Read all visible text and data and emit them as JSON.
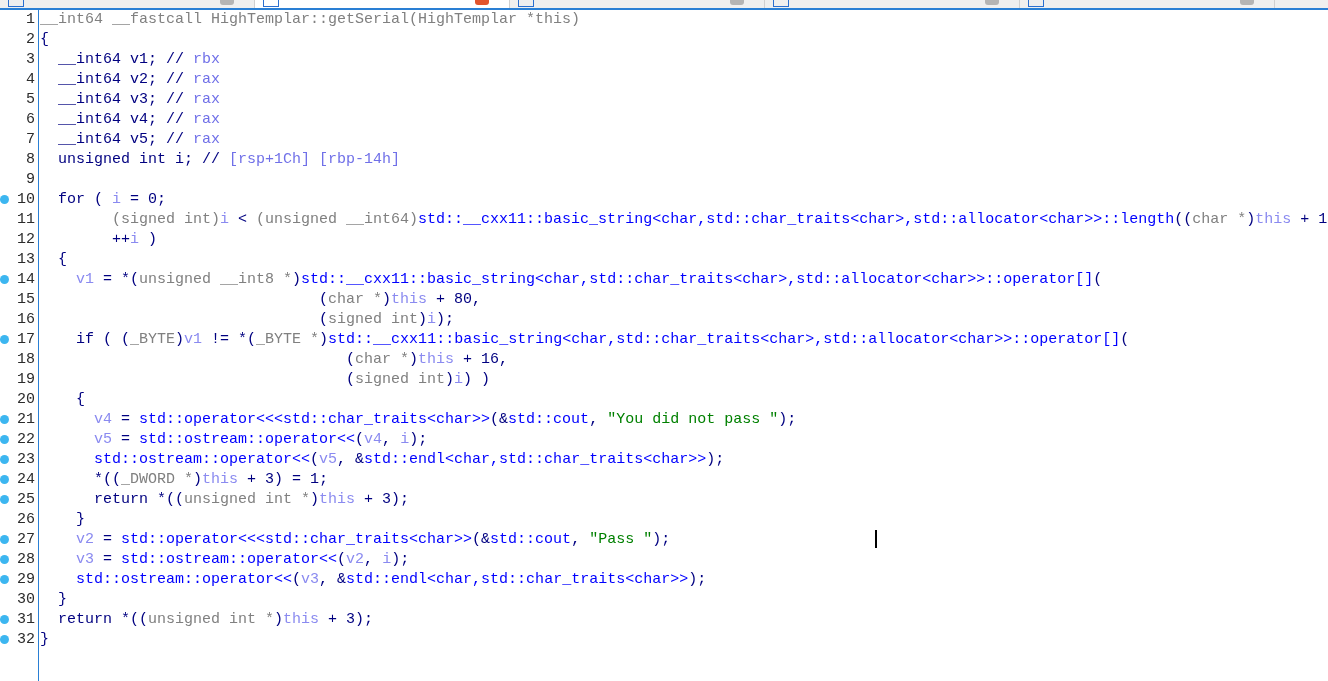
{
  "tabs": [
    {
      "selected": false
    },
    {
      "selected": true
    },
    {
      "selected": false
    },
    {
      "selected": false
    },
    {
      "selected": false
    }
  ],
  "lines": [
    {
      "n": "1",
      "bp": false,
      "tokens": [
        {
          "kind": "type",
          "t": "__int64 __fastcall HighTemplar::getSerial(HighTemplar *this)"
        }
      ]
    },
    {
      "n": "2",
      "bp": false,
      "tokens": [
        {
          "kind": "plain",
          "t": "{"
        }
      ]
    },
    {
      "n": "3",
      "bp": false,
      "tokens": [
        {
          "kind": "plain",
          "t": "  __int64 v1; // "
        },
        {
          "kind": "comment",
          "t": "rbx"
        }
      ]
    },
    {
      "n": "4",
      "bp": false,
      "tokens": [
        {
          "kind": "plain",
          "t": "  __int64 v2; // "
        },
        {
          "kind": "comment",
          "t": "rax"
        }
      ]
    },
    {
      "n": "5",
      "bp": false,
      "tokens": [
        {
          "kind": "plain",
          "t": "  __int64 v3; // "
        },
        {
          "kind": "comment",
          "t": "rax"
        }
      ]
    },
    {
      "n": "6",
      "bp": false,
      "tokens": [
        {
          "kind": "plain",
          "t": "  __int64 v4; // "
        },
        {
          "kind": "comment",
          "t": "rax"
        }
      ]
    },
    {
      "n": "7",
      "bp": false,
      "tokens": [
        {
          "kind": "plain",
          "t": "  __int64 v5; // "
        },
        {
          "kind": "comment",
          "t": "rax"
        }
      ]
    },
    {
      "n": "8",
      "bp": false,
      "tokens": [
        {
          "kind": "plain",
          "t": "  unsigned int i; // "
        },
        {
          "kind": "comment",
          "t": "[rsp+1Ch] [rbp-14h]"
        }
      ]
    },
    {
      "n": "9",
      "bp": false
    },
    {
      "n": "10",
      "bp": true,
      "tokens": [
        {
          "kind": "plain",
          "t": "  for ( "
        },
        {
          "kind": "var",
          "t": "i"
        },
        {
          "kind": "plain",
          "t": " = 0;"
        }
      ]
    },
    {
      "n": "11",
      "bp": false,
      "tokens": [
        {
          "kind": "type",
          "t": "        (signed int)"
        },
        {
          "kind": "var",
          "t": "i"
        },
        {
          "kind": "plain",
          "t": " < "
        },
        {
          "kind": "type",
          "t": "(unsigned __int64)"
        },
        {
          "kind": "func",
          "t": "std::__cxx11::basic_string<char,std::char_traits<char>,std::allocator<char>>::length"
        },
        {
          "kind": "plain",
          "t": "(("
        },
        {
          "kind": "type",
          "t": "char *"
        },
        {
          "kind": "plain",
          "t": ")"
        },
        {
          "kind": "var",
          "t": "this"
        },
        {
          "kind": "plain",
          "t": " + 1"
        }
      ]
    },
    {
      "n": "12",
      "bp": false,
      "tokens": [
        {
          "kind": "plain",
          "t": "        ++"
        },
        {
          "kind": "var",
          "t": "i"
        },
        {
          "kind": "plain",
          "t": " )"
        }
      ]
    },
    {
      "n": "13",
      "bp": false,
      "tokens": [
        {
          "kind": "plain",
          "t": "  {"
        }
      ]
    },
    {
      "n": "14",
      "bp": true,
      "tokens": [
        {
          "kind": "var",
          "t": "    v1"
        },
        {
          "kind": "plain",
          "t": " = *("
        },
        {
          "kind": "type",
          "t": "unsigned __int8 *"
        },
        {
          "kind": "plain",
          "t": ")"
        },
        {
          "kind": "func",
          "t": "std::__cxx11::basic_string<char,std::char_traits<char>,std::allocator<char>>::operator[]"
        },
        {
          "kind": "plain",
          "t": "("
        }
      ]
    },
    {
      "n": "15",
      "bp": false,
      "tokens": [
        {
          "kind": "plain",
          "t": "                               ("
        },
        {
          "kind": "type",
          "t": "char *"
        },
        {
          "kind": "plain",
          "t": ")"
        },
        {
          "kind": "var",
          "t": "this"
        },
        {
          "kind": "plain",
          "t": " + 80,"
        }
      ]
    },
    {
      "n": "16",
      "bp": false,
      "tokens": [
        {
          "kind": "plain",
          "t": "                               ("
        },
        {
          "kind": "type",
          "t": "signed int"
        },
        {
          "kind": "plain",
          "t": ")"
        },
        {
          "kind": "var",
          "t": "i"
        },
        {
          "kind": "plain",
          "t": ");"
        }
      ]
    },
    {
      "n": "17",
      "bp": true,
      "tokens": [
        {
          "kind": "plain",
          "t": "    if ( ("
        },
        {
          "kind": "type",
          "t": "_BYTE"
        },
        {
          "kind": "plain",
          "t": ")"
        },
        {
          "kind": "var",
          "t": "v1"
        },
        {
          "kind": "plain",
          "t": " != *("
        },
        {
          "kind": "type",
          "t": "_BYTE *"
        },
        {
          "kind": "plain",
          "t": ")"
        },
        {
          "kind": "func",
          "t": "std::__cxx11::basic_string<char,std::char_traits<char>,std::allocator<char>>::operator[]"
        },
        {
          "kind": "plain",
          "t": "("
        }
      ]
    },
    {
      "n": "18",
      "bp": false,
      "tokens": [
        {
          "kind": "plain",
          "t": "                                  ("
        },
        {
          "kind": "type",
          "t": "char *"
        },
        {
          "kind": "plain",
          "t": ")"
        },
        {
          "kind": "var",
          "t": "this"
        },
        {
          "kind": "plain",
          "t": " + 16,"
        }
      ]
    },
    {
      "n": "19",
      "bp": false,
      "tokens": [
        {
          "kind": "plain",
          "t": "                                  ("
        },
        {
          "kind": "type",
          "t": "signed int"
        },
        {
          "kind": "plain",
          "t": ")"
        },
        {
          "kind": "var",
          "t": "i"
        },
        {
          "kind": "plain",
          "t": ") )"
        }
      ]
    },
    {
      "n": "20",
      "bp": false,
      "tokens": [
        {
          "kind": "plain",
          "t": "    {"
        }
      ]
    },
    {
      "n": "21",
      "bp": true,
      "tokens": [
        {
          "kind": "var",
          "t": "      v4"
        },
        {
          "kind": "plain",
          "t": " = "
        },
        {
          "kind": "func",
          "t": "std::operator<<<std::char_traits<char>>"
        },
        {
          "kind": "plain",
          "t": "(&"
        },
        {
          "kind": "func",
          "t": "std::cout"
        },
        {
          "kind": "plain",
          "t": ", "
        },
        {
          "kind": "string",
          "t": "\"You did not pass \""
        },
        {
          "kind": "plain",
          "t": ");"
        }
      ]
    },
    {
      "n": "22",
      "bp": true,
      "tokens": [
        {
          "kind": "var",
          "t": "      v5"
        },
        {
          "kind": "plain",
          "t": " = "
        },
        {
          "kind": "func",
          "t": "std::ostream::operator<<"
        },
        {
          "kind": "plain",
          "t": "("
        },
        {
          "kind": "var",
          "t": "v4"
        },
        {
          "kind": "plain",
          "t": ", "
        },
        {
          "kind": "var",
          "t": "i"
        },
        {
          "kind": "plain",
          "t": ");"
        }
      ]
    },
    {
      "n": "23",
      "bp": true,
      "tokens": [
        {
          "kind": "func",
          "t": "      std::ostream::operator<<"
        },
        {
          "kind": "plain",
          "t": "("
        },
        {
          "kind": "var",
          "t": "v5"
        },
        {
          "kind": "plain",
          "t": ", &"
        },
        {
          "kind": "func",
          "t": "std::endl<char,std::char_traits<char>>"
        },
        {
          "kind": "plain",
          "t": ");"
        }
      ]
    },
    {
      "n": "24",
      "bp": true,
      "tokens": [
        {
          "kind": "plain",
          "t": "      *(("
        },
        {
          "kind": "type",
          "t": "_DWORD *"
        },
        {
          "kind": "plain",
          "t": ")"
        },
        {
          "kind": "var",
          "t": "this"
        },
        {
          "kind": "plain",
          "t": " + 3) = 1;"
        }
      ]
    },
    {
      "n": "25",
      "bp": true,
      "tokens": [
        {
          "kind": "plain",
          "t": "      return *(("
        },
        {
          "kind": "type",
          "t": "unsigned int *"
        },
        {
          "kind": "plain",
          "t": ")"
        },
        {
          "kind": "var",
          "t": "this"
        },
        {
          "kind": "plain",
          "t": " + 3);"
        }
      ]
    },
    {
      "n": "26",
      "bp": false,
      "tokens": [
        {
          "kind": "plain",
          "t": "    }"
        }
      ]
    },
    {
      "n": "27",
      "bp": true,
      "tokens": [
        {
          "kind": "var",
          "t": "    v2"
        },
        {
          "kind": "plain",
          "t": " = "
        },
        {
          "kind": "func",
          "t": "std::operator<<<std::char_traits<char>>"
        },
        {
          "kind": "plain",
          "t": "(&"
        },
        {
          "kind": "func",
          "t": "std::cout"
        },
        {
          "kind": "plain",
          "t": ", "
        },
        {
          "kind": "string",
          "t": "\"Pass \""
        },
        {
          "kind": "plain",
          "t": ");"
        }
      ]
    },
    {
      "n": "28",
      "bp": true,
      "tokens": [
        {
          "kind": "var",
          "t": "    v3"
        },
        {
          "kind": "plain",
          "t": " = "
        },
        {
          "kind": "func",
          "t": "std::ostream::operator<<"
        },
        {
          "kind": "plain",
          "t": "("
        },
        {
          "kind": "var",
          "t": "v2"
        },
        {
          "kind": "plain",
          "t": ", "
        },
        {
          "kind": "var",
          "t": "i"
        },
        {
          "kind": "plain",
          "t": ");"
        }
      ]
    },
    {
      "n": "29",
      "bp": true,
      "tokens": [
        {
          "kind": "func",
          "t": "    std::ostream::operator<<"
        },
        {
          "kind": "plain",
          "t": "("
        },
        {
          "kind": "var",
          "t": "v3"
        },
        {
          "kind": "plain",
          "t": ", &"
        },
        {
          "kind": "func",
          "t": "std::endl<char,std::char_traits<char>>"
        },
        {
          "kind": "plain",
          "t": ");"
        }
      ]
    },
    {
      "n": "30",
      "bp": false,
      "tokens": [
        {
          "kind": "plain",
          "t": "  }"
        }
      ]
    },
    {
      "n": "31",
      "bp": true,
      "tokens": [
        {
          "kind": "plain",
          "t": "  return *(("
        },
        {
          "kind": "type",
          "t": "unsigned int *"
        },
        {
          "kind": "plain",
          "t": ")"
        },
        {
          "kind": "var",
          "t": "this"
        },
        {
          "kind": "plain",
          "t": " + 3);"
        }
      ]
    },
    {
      "n": "32",
      "bp": true,
      "tokens": [
        {
          "kind": "plain",
          "t": "}"
        }
      ]
    }
  ]
}
